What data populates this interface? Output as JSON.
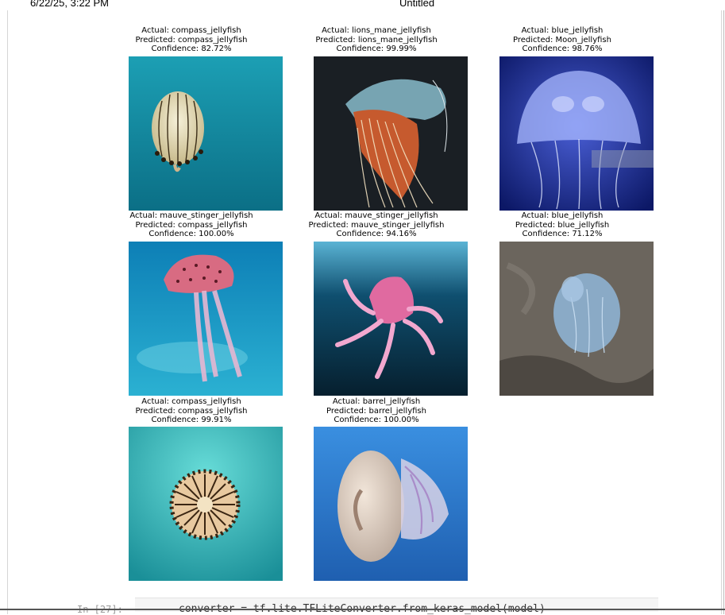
{
  "header": {
    "date": "6/22/25, 3:22 PM",
    "title": "Untitled"
  },
  "tiles": [
    {
      "actual": "Actual: compass_jellyfish",
      "predicted": "Predicted: compass_jellyfish",
      "confidence": "Confidence: 82.72%",
      "image": "compass-jellyfish-photo"
    },
    {
      "actual": "Actual: lions_mane_jellyfish",
      "predicted": "Predicted: lions_mane_jellyfish",
      "confidence": "Confidence: 99.99%",
      "image": "lions-mane-jellyfish-photo"
    },
    {
      "actual": "Actual: blue_jellyfish",
      "predicted": "Predicted: Moon_jellyfish",
      "confidence": "Confidence: 98.76%",
      "image": "moon-jellyfish-photo"
    },
    {
      "actual": "Actual: mauve_stinger_jellyfish",
      "predicted": "Predicted: compass_jellyfish",
      "confidence": "Confidence: 100.00%",
      "image": "mauve-stinger-jellyfish-photo"
    },
    {
      "actual": "Actual: mauve_stinger_jellyfish",
      "predicted": "Predicted: mauve_stinger_jellyfish",
      "confidence": "Confidence: 94.16%",
      "image": "mauve-stinger-jellyfish-photo-2"
    },
    {
      "actual": "Actual: blue_jellyfish",
      "predicted": "Predicted: blue_jellyfish",
      "confidence": "Confidence: 71.12%",
      "image": "blue-jellyfish-on-sand-photo"
    },
    {
      "actual": "Actual: compass_jellyfish",
      "predicted": "Predicted: compass_jellyfish",
      "confidence": "Confidence: 99.91%",
      "image": "compass-jellyfish-topview-photo"
    },
    {
      "actual": "Actual: barrel_jellyfish",
      "predicted": "Predicted: barrel_jellyfish",
      "confidence": "Confidence: 100.00%",
      "image": "barrel-jellyfish-photo"
    }
  ],
  "code_cell": {
    "prompt": "In [27]:",
    "code": "converter = tf.lite.TFLiteConverter.from_keras_model(model)"
  }
}
